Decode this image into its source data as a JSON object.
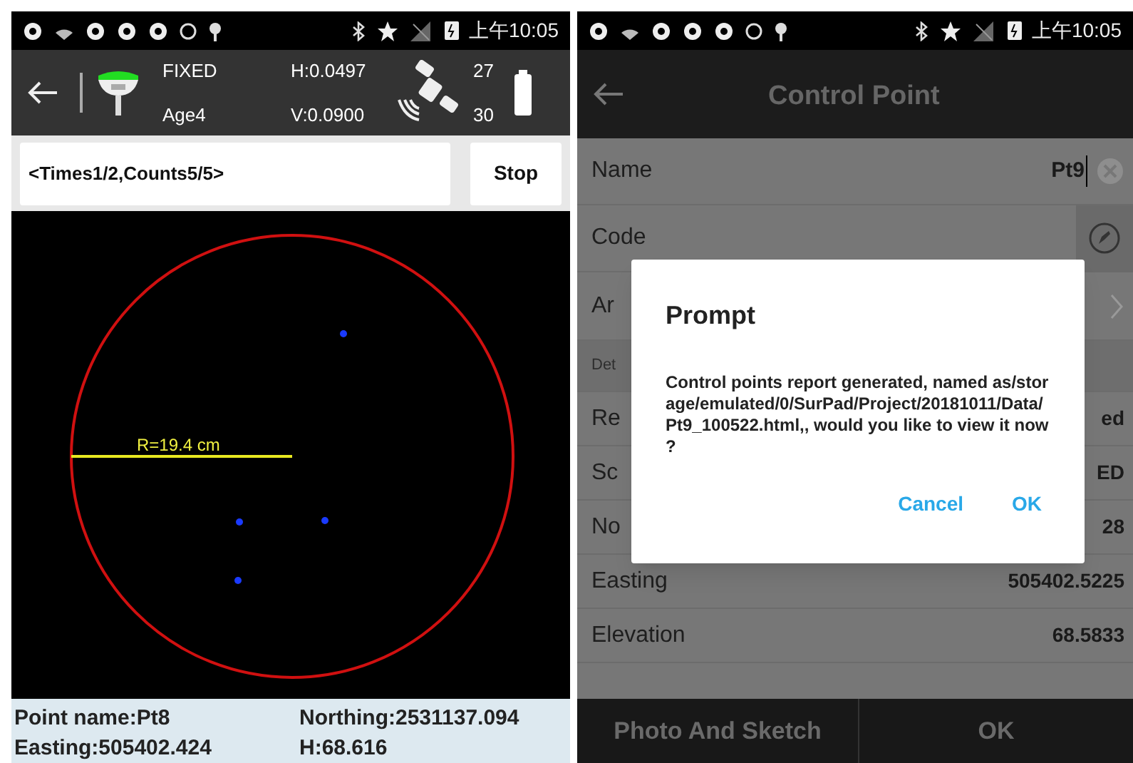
{
  "left": {
    "status_time": "上午10:05",
    "header": {
      "fix_status": "FIXED",
      "age": "Age4",
      "h_precision": "H:0.0497",
      "v_precision": "V:0.0900",
      "satellites_used": "27",
      "satellites_visible": "30"
    },
    "progress_field": {
      "value": "<Times1/2,Counts5/5>"
    },
    "stop_button": "Stop",
    "plot": {
      "radius_label": "R=19.4 cm"
    },
    "info": [
      "Point name:Pt8",
      "Northing:2531137.094",
      "Easting:505402.424",
      "H:68.616"
    ]
  },
  "right": {
    "status_time": "上午10:05",
    "title": "Control Point",
    "rows": [
      {
        "kind": "input",
        "label": "Name",
        "value": "Pt9"
      },
      {
        "kind": "edit",
        "label": "Code"
      },
      {
        "kind": "link",
        "label": "Ar"
      },
      {
        "kind": "section",
        "label": "Det"
      },
      {
        "kind": "value",
        "label": "Re",
        "value": "ed"
      },
      {
        "kind": "value",
        "label": "Sc",
        "value": "ED"
      },
      {
        "kind": "value",
        "label": "No",
        "value": "28"
      },
      {
        "kind": "value",
        "label": "Easting",
        "value": "505402.5225"
      },
      {
        "kind": "value",
        "label": "Elevation",
        "value": "68.5833"
      }
    ],
    "buttons": [
      "Photo And Sketch",
      "OK"
    ],
    "dialog": {
      "title": "Prompt",
      "message": "Control points report generated, named as/storage/emulated/0/SurPad/Project/20181011/Data/Pt9_100522.html,, would you like to view it now ?",
      "buttons": [
        "Cancel",
        "OK"
      ]
    }
  }
}
